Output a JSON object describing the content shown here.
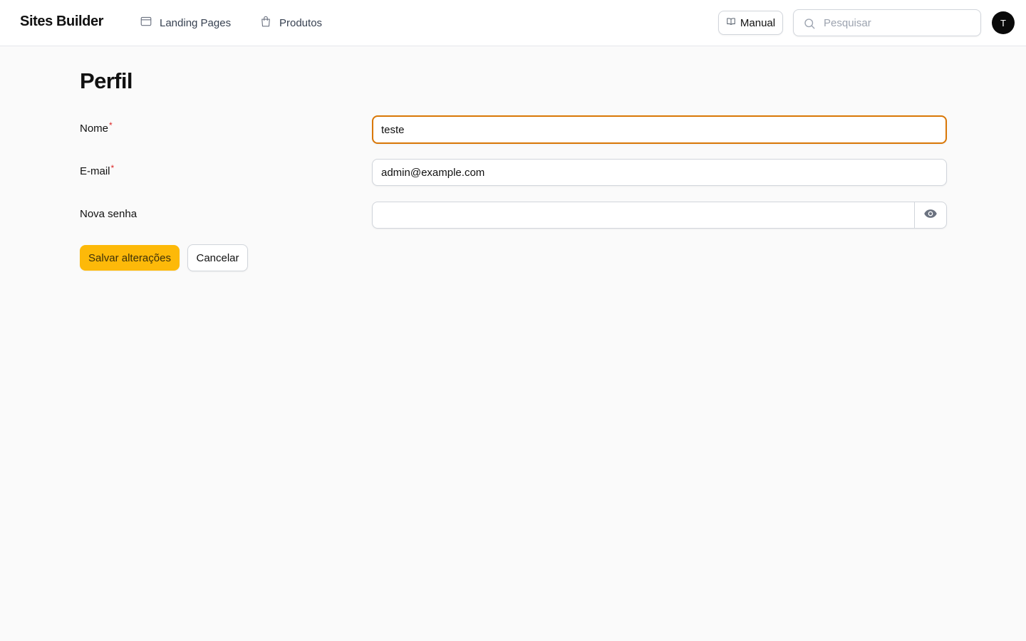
{
  "header": {
    "brand": "Sites Builder",
    "nav": [
      {
        "label": "Landing Pages",
        "icon": "browser-window-icon"
      },
      {
        "label": "Produtos",
        "icon": "shopping-bag-icon"
      }
    ],
    "manual_label": "Manual",
    "search": {
      "placeholder": "Pesquisar",
      "value": ""
    },
    "avatar_initial": "T"
  },
  "page": {
    "title": "Perfil"
  },
  "form": {
    "name": {
      "label": "Nome",
      "required_mark": "*",
      "value": "teste"
    },
    "email": {
      "label": "E-mail",
      "required_mark": "*",
      "value": "admin@example.com"
    },
    "password": {
      "label": "Nova senha",
      "value": "",
      "toggle_icon": "eye-icon"
    }
  },
  "actions": {
    "save_label": "Salvar alterações",
    "cancel_label": "Cancelar"
  },
  "colors": {
    "accent": "#fdb909",
    "focus_ring": "#d97706",
    "required": "#dc2626",
    "page_background": "#fafafa"
  }
}
